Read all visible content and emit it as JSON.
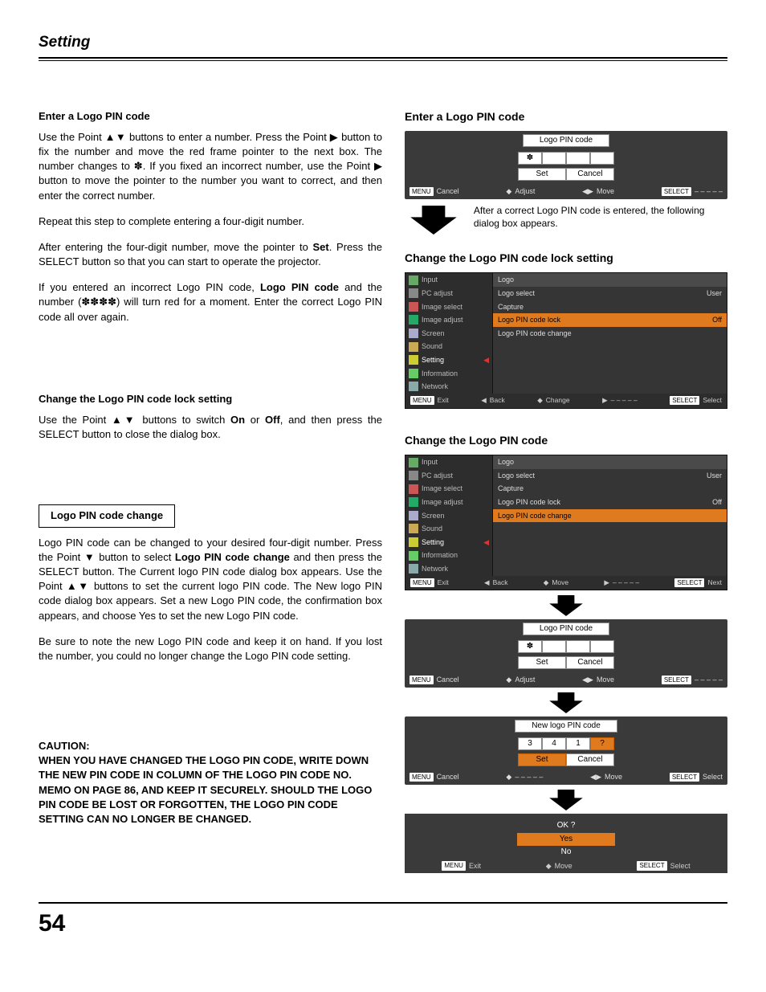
{
  "page": {
    "title": "Setting",
    "number": "54"
  },
  "left": {
    "h1": "Enter a Logo PIN code",
    "p1a": "Use the Point ▲▼ buttons to enter a number. Press the Point ▶ button to fix the number and move the red frame pointer to the next box. The number changes to ✽. If you fixed an incorrect number, use the Point ▶ button to move the pointer to the number you want to correct, and then enter the correct number.",
    "p1b": "Repeat this step to complete entering a four-digit number.",
    "p1c_a": "After entering the four-digit number, move the pointer to ",
    "p1c_set": "Set",
    "p1c_b": ". Press the SELECT button so that you can start to operate the projector.",
    "p1d_a": "If you entered an incorrect Logo PIN code, ",
    "p1d_logo": "Logo PIN code",
    "p1d_b": " and the number (✽✽✽✽) will turn red for a moment. Enter the correct Logo PIN code all over again.",
    "h2": "Change the Logo PIN code lock setting",
    "p2_a": "Use the Point ▲▼ buttons to switch ",
    "p2_on": "On",
    "p2_or": " or ",
    "p2_off": "Off",
    "p2_b": ", and then press the SELECT button to close the dialog box.",
    "boxlabel": "Logo PIN code change",
    "p3_a": "Logo PIN code can be changed to your desired four-digit number. Press the Point ▼ button to select ",
    "p3_bold": "Logo PIN code change",
    "p3_b": " and then press the SELECT button. The Current logo PIN code dialog box appears. Use the Point ▲▼ buttons to set the current logo PIN code. The New logo PIN code dialog box appears. Set a new Logo PIN code, the confirmation box appears, and choose Yes to set the new Logo PIN code.",
    "p3c": "Be sure to note the new Logo PIN code and keep it on hand. If you lost the number, you could no longer change the Logo PIN code setting.",
    "caution_h": "CAUTION:",
    "caution_t": "WHEN YOU HAVE CHANGED THE LOGO PIN CODE, WRITE DOWN THE NEW PIN CODE IN COLUMN OF THE LOGO PIN CODE NO. MEMO ON PAGE 86, AND KEEP IT SECURELY. SHOULD THE LOGO PIN CODE BE LOST OR FORGOTTEN, THE LOGO PIN CODE SETTING CAN NO LONGER BE CHANGED."
  },
  "right": {
    "h1": "Enter a Logo PIN code",
    "annot": "After a correct Logo PIN code is entered, the following dialog box appears.",
    "h2": "Change the Logo PIN code lock setting",
    "h3": "Change the Logo PIN code"
  },
  "pin_dialog": {
    "title": "Logo PIN code",
    "mask": "✽",
    "set": "Set",
    "cancel": "Cancel",
    "foot_menu": "MENU",
    "foot_cancel": "Cancel",
    "foot_adjust": "Adjust",
    "foot_move": "Move",
    "foot_select": "SELECT",
    "foot_dash": "– – – – –"
  },
  "new_pin_dialog": {
    "title": "New logo PIN code",
    "cells": [
      "3",
      "4",
      "1",
      "?"
    ],
    "set": "Set",
    "cancel": "Cancel"
  },
  "ok_dialog": {
    "title": "OK ?",
    "yes": "Yes",
    "no": "No",
    "exit": "Exit",
    "move": "Move",
    "select": "Select",
    "tag_menu": "MENU",
    "tag_select": "SELECT"
  },
  "menu": {
    "header_left": "Logo",
    "side": [
      "Input",
      "PC adjust",
      "Image select",
      "Image adjust",
      "Screen",
      "Sound",
      "Setting",
      "Information",
      "Network"
    ],
    "rows_lock": [
      {
        "l": "Logo select",
        "r": "User"
      },
      {
        "l": "Capture",
        "r": ""
      },
      {
        "l": "Logo PIN code lock",
        "r": "Off",
        "hi": true
      },
      {
        "l": "Logo PIN code change",
        "r": ""
      }
    ],
    "rows_change": [
      {
        "l": "Logo select",
        "r": "User"
      },
      {
        "l": "Capture",
        "r": ""
      },
      {
        "l": "Logo PIN code lock",
        "r": "Off"
      },
      {
        "l": "Logo PIN code change",
        "r": "",
        "hi": true
      }
    ],
    "foot": {
      "menu": "MENU",
      "exit": "Exit",
      "back": "Back",
      "change": "Change",
      "dash": "– – – – –",
      "select_tag": "SELECT",
      "select": "Select",
      "move": "Move",
      "next": "Next"
    }
  }
}
